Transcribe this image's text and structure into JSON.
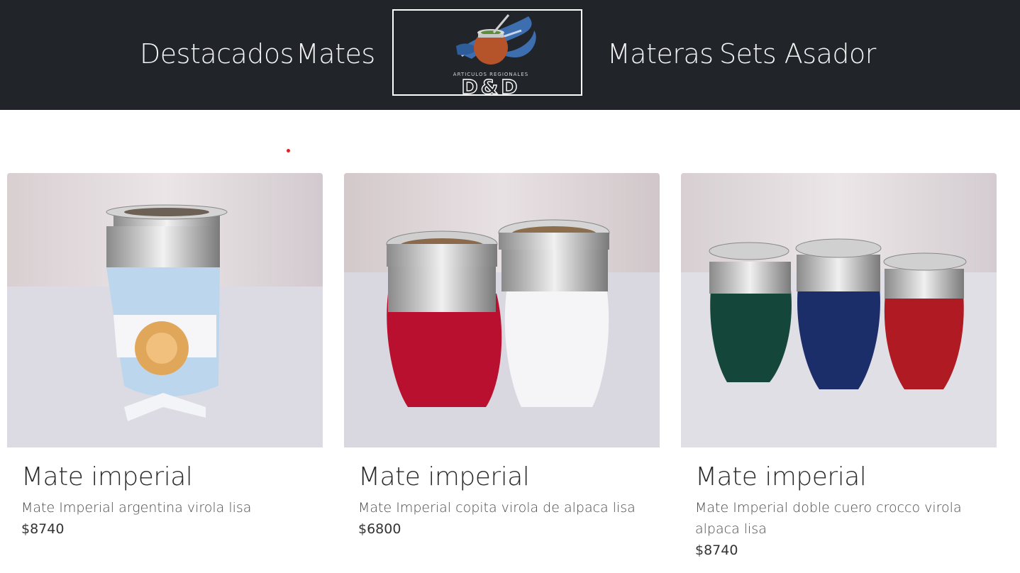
{
  "nav": {
    "items": [
      {
        "label": "Destacados"
      },
      {
        "label": "Mates"
      },
      {
        "label": "Materas"
      },
      {
        "label": "Sets Asador"
      }
    ],
    "logo": {
      "subtitle": "ARTICULOS REGIONALES",
      "brand": "D&D"
    }
  },
  "products": [
    {
      "title": "Mate imperial",
      "description": "Mate Imperial argentina virola lisa",
      "price": "$8740"
    },
    {
      "title": "Mate imperial",
      "description": "Mate Imperial copita virola de alpaca lisa",
      "price": "$6800"
    },
    {
      "title": "Mate imperial",
      "description": "Mate Imperial doble cuero crocco virola alpaca lisa",
      "price": "$8740"
    }
  ],
  "colors": {
    "navbar_bg": "#212429",
    "nav_text": "#f3f3f3",
    "accent_dot": "#e02020"
  }
}
